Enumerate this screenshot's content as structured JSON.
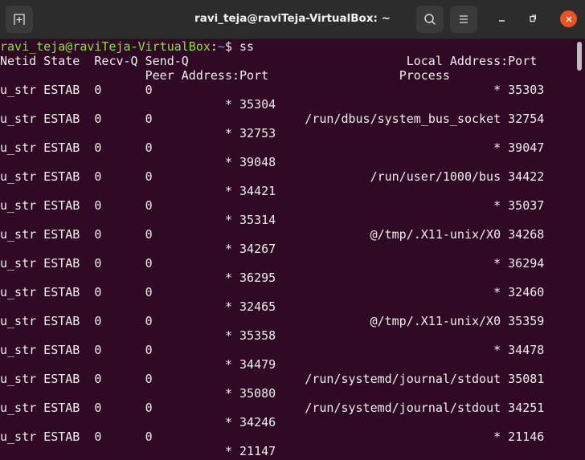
{
  "window": {
    "title": "ravi_teja@raviTeja-VirtualBox: ~",
    "buttons": [
      "new-tab",
      "search",
      "menu",
      "minimize",
      "maximize",
      "close"
    ],
    "close_color": "#e95420"
  },
  "terminal": {
    "prompt": {
      "user_host": "ravi_teja@raviTeja-VirtualBox",
      "colon": ":",
      "path": "~",
      "symbol": "$",
      "command": " ss"
    },
    "header": {
      "netid": "Netid",
      "state": "State",
      "recv_q": "Recv-Q",
      "send_q": "Send-Q",
      "local": "Local Address:Port",
      "peer": "Peer Address:Port",
      "process": "Process"
    },
    "rows": [
      {
        "netid": "u_str",
        "state": "ESTAB",
        "recv_q": "0",
        "send_q": "0",
        "local": "* 35303",
        "peer": "* 35304"
      },
      {
        "netid": "u_str",
        "state": "ESTAB",
        "recv_q": "0",
        "send_q": "0",
        "local": "/run/dbus/system_bus_socket 32754",
        "peer": "* 32753"
      },
      {
        "netid": "u_str",
        "state": "ESTAB",
        "recv_q": "0",
        "send_q": "0",
        "local": "* 39047",
        "peer": "* 39048"
      },
      {
        "netid": "u_str",
        "state": "ESTAB",
        "recv_q": "0",
        "send_q": "0",
        "local": "/run/user/1000/bus 34422",
        "peer": "* 34421"
      },
      {
        "netid": "u_str",
        "state": "ESTAB",
        "recv_q": "0",
        "send_q": "0",
        "local": "* 35037",
        "peer": "* 35314"
      },
      {
        "netid": "u_str",
        "state": "ESTAB",
        "recv_q": "0",
        "send_q": "0",
        "local": "@/tmp/.X11-unix/X0 34268",
        "peer": "* 34267"
      },
      {
        "netid": "u_str",
        "state": "ESTAB",
        "recv_q": "0",
        "send_q": "0",
        "local": "* 36294",
        "peer": "* 36295"
      },
      {
        "netid": "u_str",
        "state": "ESTAB",
        "recv_q": "0",
        "send_q": "0",
        "local": "* 32460",
        "peer": "* 32465"
      },
      {
        "netid": "u_str",
        "state": "ESTAB",
        "recv_q": "0",
        "send_q": "0",
        "local": "@/tmp/.X11-unix/X0 35359",
        "peer": "* 35358"
      },
      {
        "netid": "u_str",
        "state": "ESTAB",
        "recv_q": "0",
        "send_q": "0",
        "local": "* 34478",
        "peer": "* 34479"
      },
      {
        "netid": "u_str",
        "state": "ESTAB",
        "recv_q": "0",
        "send_q": "0",
        "local": "/run/systemd/journal/stdout 35081",
        "peer": "* 35080"
      },
      {
        "netid": "u_str",
        "state": "ESTAB",
        "recv_q": "0",
        "send_q": "0",
        "local": "/run/systemd/journal/stdout 34251",
        "peer": "* 34246"
      },
      {
        "netid": "u_str",
        "state": "ESTAB",
        "recv_q": "0",
        "send_q": "0",
        "local": "* 21146",
        "peer": "* 21147"
      }
    ]
  }
}
